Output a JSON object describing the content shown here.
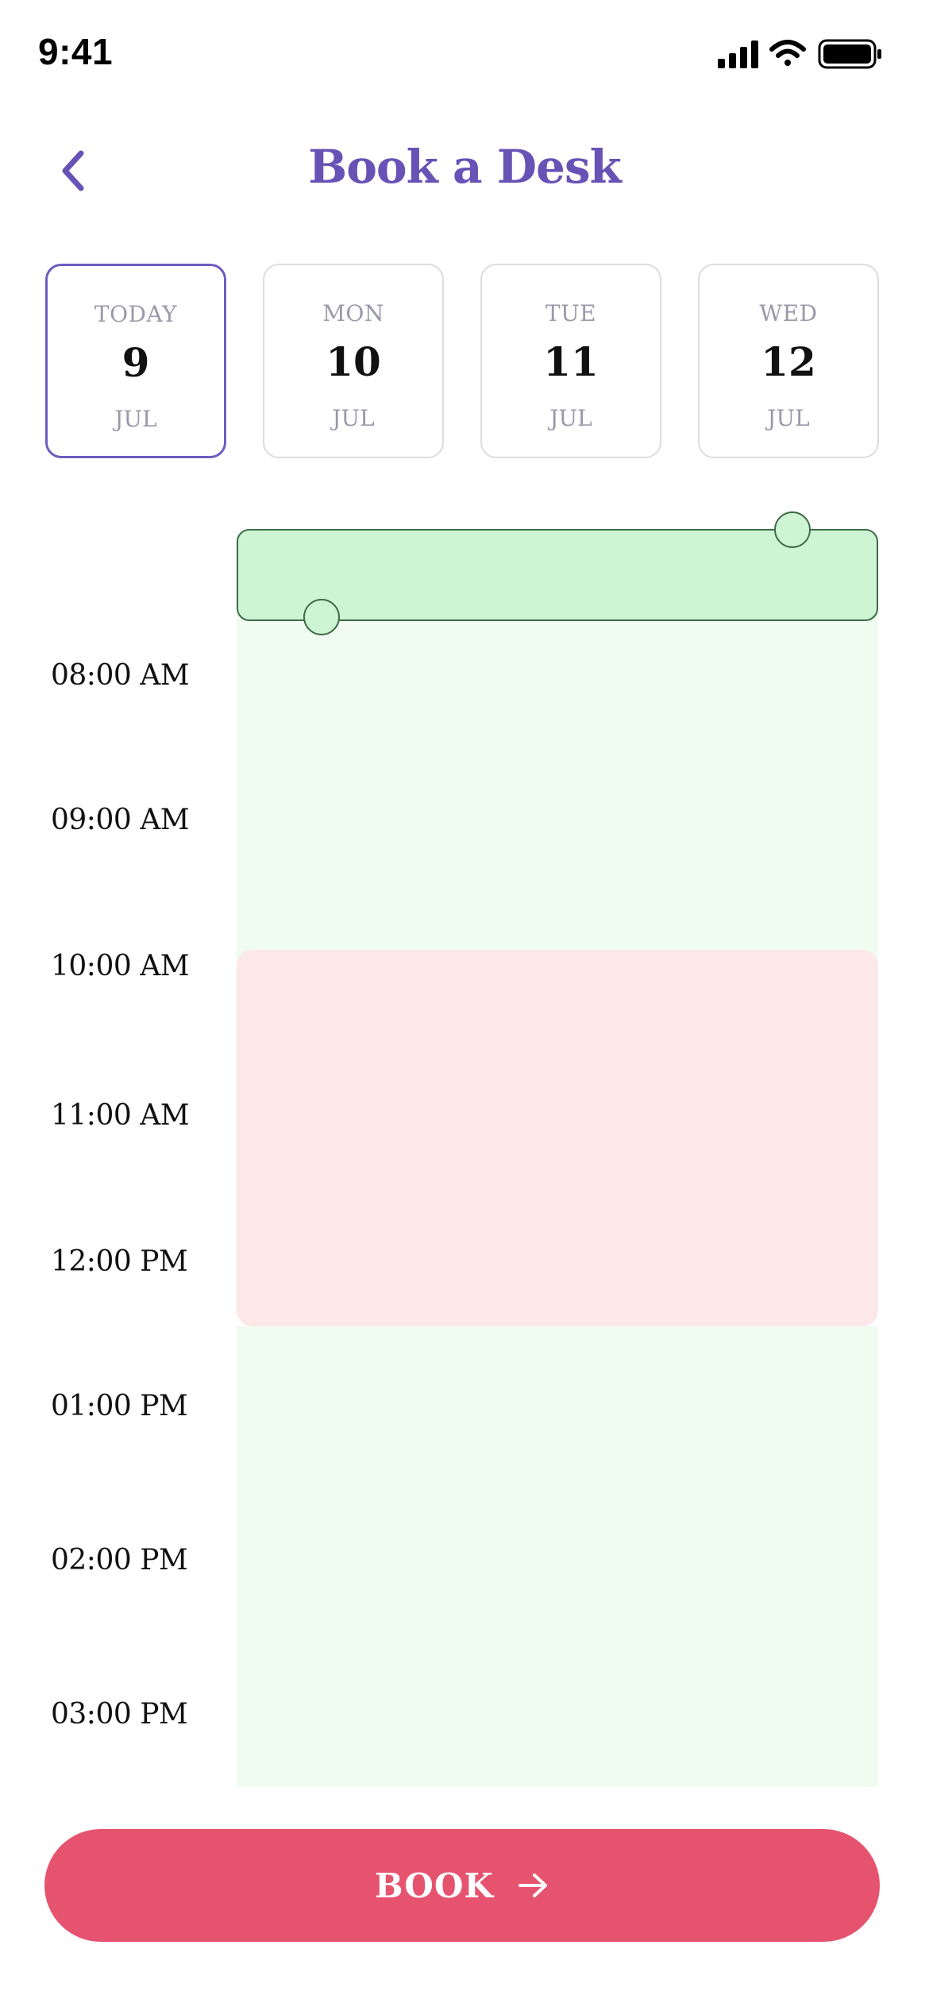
{
  "status_bar": {
    "time": "9:41"
  },
  "header": {
    "title": "Book a Desk"
  },
  "dates": [
    {
      "dow": "TODAY",
      "day": "9",
      "month": "JUL",
      "selected": true
    },
    {
      "dow": "MON",
      "day": "10",
      "month": "JUL",
      "selected": false
    },
    {
      "dow": "TUE",
      "day": "11",
      "month": "JUL",
      "selected": false
    },
    {
      "dow": "WED",
      "day": "12",
      "month": "JUL",
      "selected": false
    }
  ],
  "schedule": {
    "times": [
      "08:00 AM",
      "09:00 AM",
      "10:00 AM",
      "11:00 AM",
      "12:00 PM",
      "01:00 PM",
      "02:00 PM",
      "03:00 PM"
    ]
  },
  "actions": {
    "book_label": "BOOK"
  },
  "colors": {
    "accent": "#6752b5",
    "available": "#effcef",
    "unavailable": "#fde8e8",
    "selection": "#cdf5d4",
    "book_button": "#e5536f"
  }
}
